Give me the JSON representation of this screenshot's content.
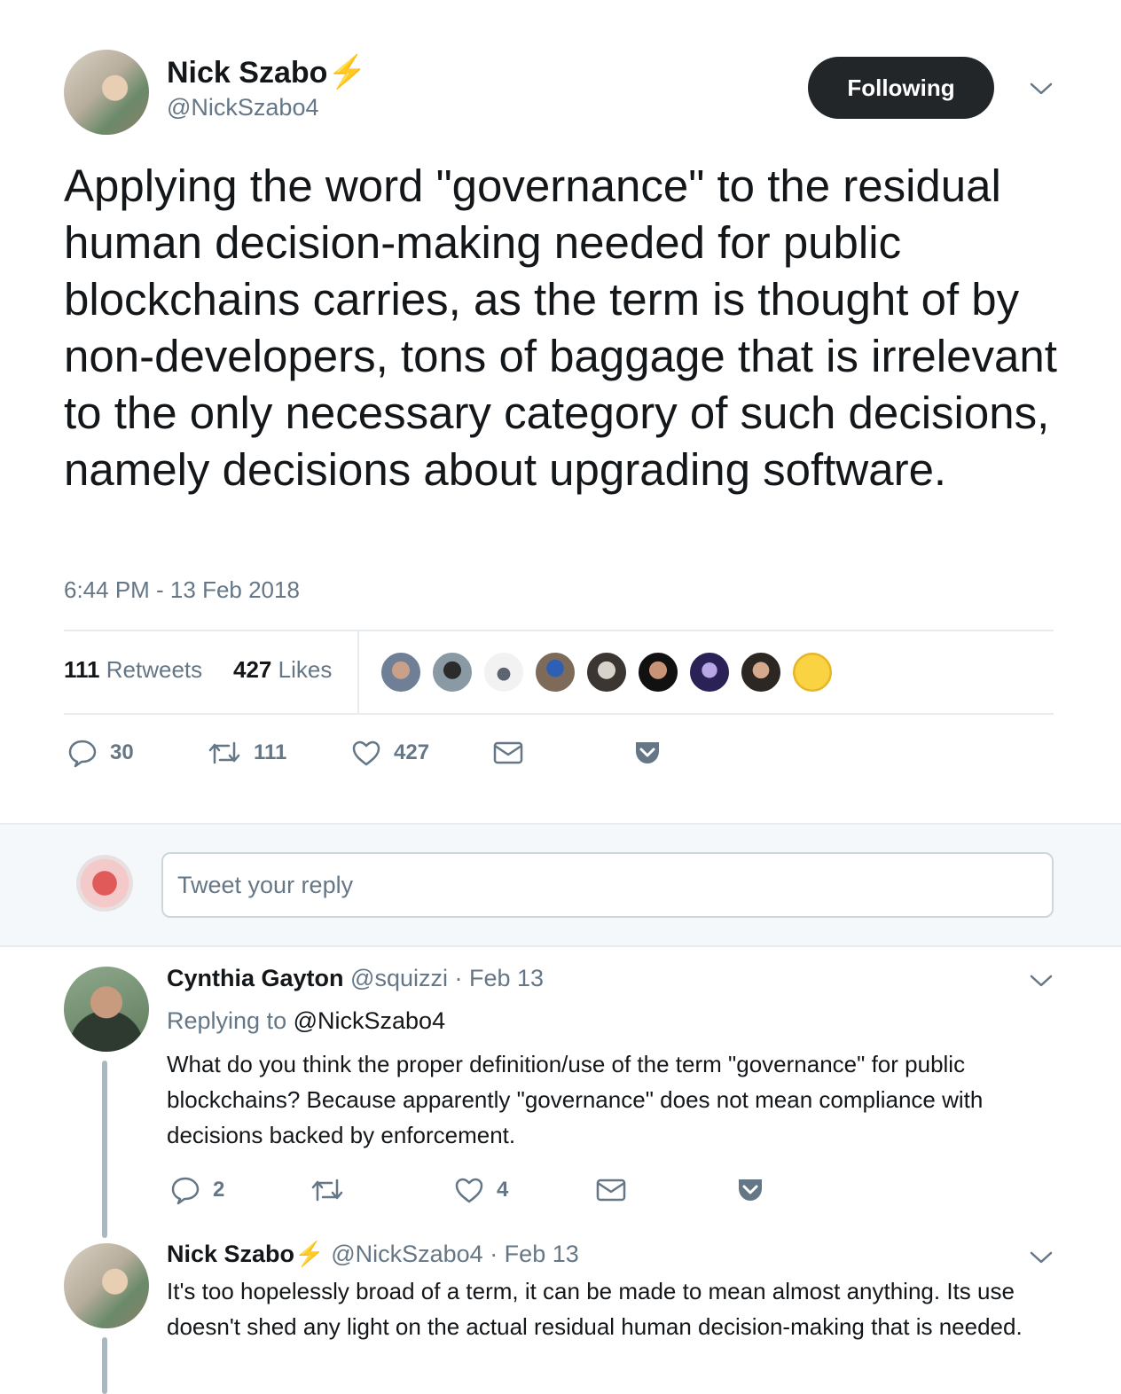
{
  "tweet": {
    "author": {
      "name": "Nick Szabo",
      "verified_symbol": "⚡",
      "handle": "@NickSzabo4"
    },
    "follow_button": "Following",
    "text": "Applying the word \"governance\" to the residual human decision-making needed for public blockchains carries, as the term is thought of by non-developers, tons of baggage that is irrelevant to the only necessary category of such decisions, namely decisions about upgrading software.",
    "timestamp": "6:44 PM - 13 Feb 2018",
    "stats": {
      "retweets_count": "111",
      "retweets_label": "Retweets",
      "likes_count": "427",
      "likes_label": "Likes"
    },
    "actions": {
      "replies": "30",
      "retweets": "111",
      "likes": "427"
    }
  },
  "reply_box": {
    "placeholder": "Tweet your reply"
  },
  "replies": [
    {
      "name": "Cynthia Gayton",
      "handle": "@squizzi",
      "date": "· Feb 13",
      "replying_prefix": "Replying to",
      "replying_to": "@NickSzabo4",
      "text": "What do you think the proper definition/use of the term \"governance\" for public blockchains? Because apparently \"governance\" does not mean compliance with decisions backed by enforcement.",
      "actions": {
        "replies": "2",
        "retweets": "",
        "likes": "4"
      }
    },
    {
      "name": "Nick Szabo",
      "verified_symbol": "⚡",
      "handle": "@NickSzabo4",
      "date": "· Feb 13",
      "text": "It's too hopelessly broad of a term, it can be made to mean almost anything. Its use doesn't shed any light on the actual residual human decision-making that is needed."
    }
  ],
  "colors": {
    "text": "#14171a",
    "muted": "#657786",
    "following_bg": "#222629",
    "bolt": "#f5a623",
    "divider": "#e6ecf0",
    "band": "#f5f8fa"
  }
}
